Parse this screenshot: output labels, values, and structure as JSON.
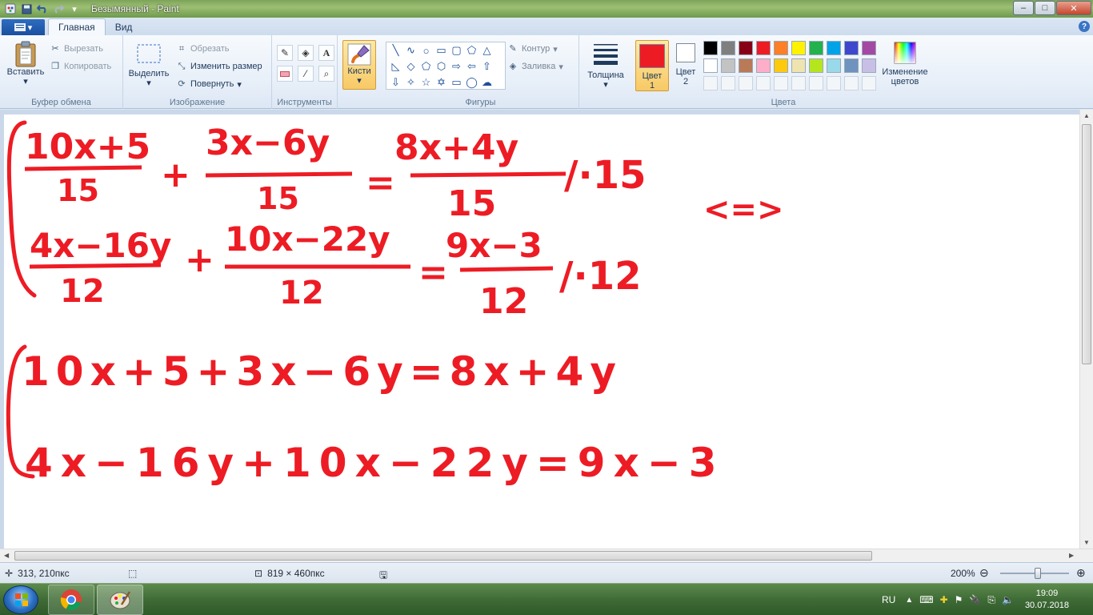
{
  "window": {
    "title": "Безымянный - Paint",
    "controls": {
      "minimize": "–",
      "maximize": "□",
      "close": "✕"
    }
  },
  "tabs": [
    {
      "label": "Главная",
      "active": true
    },
    {
      "label": "Вид",
      "active": false
    }
  ],
  "ribbon": {
    "clipboard": {
      "group_label": "Буфер обмена",
      "paste": "Вставить",
      "cut": "Вырезать",
      "copy": "Копировать"
    },
    "image": {
      "group_label": "Изображение",
      "select": "Выделить",
      "crop": "Обрезать",
      "resize": "Изменить размер",
      "rotate": "Повернуть"
    },
    "tools": {
      "group_label": "Инструменты"
    },
    "brushes": {
      "label": "Кисти"
    },
    "shapes": {
      "group_label": "Фигуры",
      "outline": "Контур",
      "fill": "Заливка"
    },
    "size": {
      "label": "Толщина"
    },
    "colors": {
      "group_label": "Цвета",
      "color1": "Цвет 1",
      "color2": "Цвет 2",
      "edit_colors": "Изменение цветов",
      "color1_value": "#ed1c24",
      "color2_value": "#ffffff",
      "palette_row1": [
        "#000000",
        "#7f7f7f",
        "#880015",
        "#ed1c24",
        "#ff7f27",
        "#fff200",
        "#22b14c",
        "#00a2e8",
        "#3f48cc",
        "#a349a4"
      ],
      "palette_row2": [
        "#ffffff",
        "#c3c3c3",
        "#b97a57",
        "#ffaec9",
        "#ffc90e",
        "#efe4b0",
        "#b5e61d",
        "#99d9ea",
        "#7092be",
        "#c8bfe7"
      ]
    }
  },
  "canvas": {
    "ink_color": "#ed1c24",
    "handwriting": {
      "r1a": "10x+5",
      "r1b": "15",
      "r1c": "3x−6y",
      "r1d": "15",
      "r1e": "8x+4y",
      "r1f": "15",
      "r1g": "/·15",
      "arrow": "<=>",
      "r2a": "4x−16y",
      "r2b": "12",
      "r2c": "10x−22y",
      "r2d": "12",
      "r2e": "9x−3",
      "r2f": "12",
      "r2g": "/·12",
      "eq3": "10x+5+3x−6y=8x+4y",
      "eq4": "4x−16y+10x−22y=9x−3"
    }
  },
  "status": {
    "cursor_position": "313, 210пкс",
    "image_size": "819 × 460пкс",
    "zoom": "200%"
  },
  "taskbar": {
    "language": "RU",
    "time": "19:09",
    "date": "30.07.2018"
  }
}
